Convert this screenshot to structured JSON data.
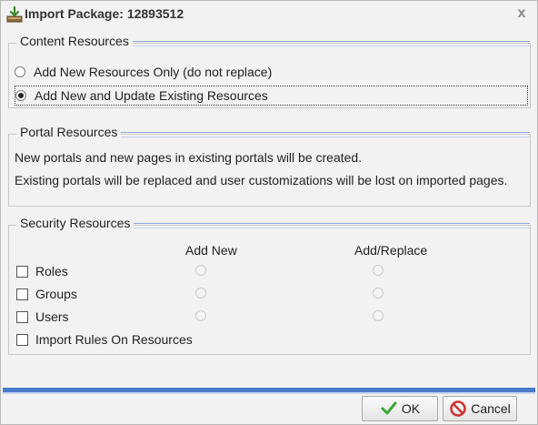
{
  "dialog": {
    "title": "Import Package: 12893512",
    "title_icon": "import-download-icon",
    "close_icon": "close-icon",
    "close_glyph": "x"
  },
  "content_resources": {
    "legend": "Content Resources",
    "options": [
      {
        "label": "Add New Resources Only (do not replace)",
        "checked": false
      },
      {
        "label": "Add New and Update Existing Resources",
        "checked": true
      }
    ]
  },
  "portal_resources": {
    "legend": "Portal Resources",
    "lines": [
      "New portals and new pages in existing portals will be created.",
      "Existing portals will be replaced and user customizations will be lost on imported pages."
    ]
  },
  "security_resources": {
    "legend": "Security Resources",
    "col_add_new": "Add New",
    "col_add_replace": "Add/Replace",
    "rows": [
      {
        "label": "Roles"
      },
      {
        "label": "Groups"
      },
      {
        "label": "Users"
      }
    ],
    "import_rules_label": "Import Rules On Resources"
  },
  "footer": {
    "ok_label": "OK",
    "cancel_label": "Cancel",
    "ok_icon": "checkmark-icon",
    "cancel_icon": "cancel-icon",
    "accent_color": "#4a7bc8"
  }
}
